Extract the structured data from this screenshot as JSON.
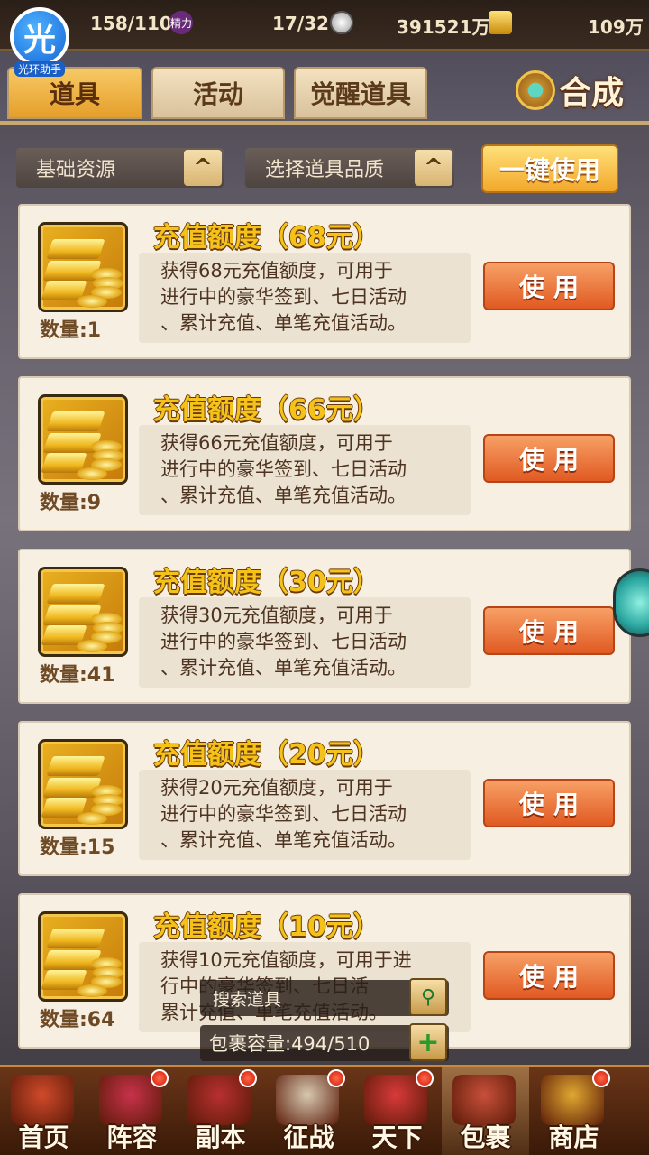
{
  "helper": {
    "badge": "光",
    "label": "光环助手"
  },
  "resources": {
    "stamina": "158/110",
    "energy_label": "精力",
    "energy": "17/32",
    "silver": "391521万",
    "gold": "109万"
  },
  "tabs": [
    {
      "label": "道具",
      "active": true
    },
    {
      "label": "活动",
      "active": false
    },
    {
      "label": "觉醒道具",
      "active": false
    }
  ],
  "combine_label": "合成",
  "filters": {
    "resource_type": "基础资源",
    "quality": "选择道具品质",
    "use_all": "一键使用"
  },
  "items": [
    {
      "title": "充值额度（68元）",
      "desc": [
        "获得68元充值额度，可用于",
        "进行中的豪华签到、七日活动",
        "、累计充值、单笔充值活动。"
      ],
      "qty": "数量:1",
      "use": "使用"
    },
    {
      "title": "充值额度（66元）",
      "desc": [
        "获得66元充值额度，可用于",
        "进行中的豪华签到、七日活动",
        "、累计充值、单笔充值活动。"
      ],
      "qty": "数量:9",
      "use": "使用"
    },
    {
      "title": "充值额度（30元）",
      "desc": [
        "获得30元充值额度，可用于",
        "进行中的豪华签到、七日活动",
        "、累计充值、单笔充值活动。"
      ],
      "qty": "数量:41",
      "use": "使用"
    },
    {
      "title": "充值额度（20元）",
      "desc": [
        "获得20元充值额度，可用于",
        "进行中的豪华签到、七日活动",
        "、累计充值、单笔充值活动。"
      ],
      "qty": "数量:15",
      "use": "使用"
    },
    {
      "title": "充值额度（10元）",
      "desc": [
        "获得10元充值额度，可用于进",
        "行中的豪华签到、七日活",
        "累计充值、单笔充值活动。"
      ],
      "qty": "数量:64",
      "use": "使用"
    }
  ],
  "search_label": "搜索道具",
  "capacity": "包裹容量:494/510",
  "nav": [
    {
      "label": "首页",
      "dot": false,
      "active": false,
      "color": "#d04a2a"
    },
    {
      "label": "阵容",
      "dot": true,
      "active": false,
      "color": "#c8324a"
    },
    {
      "label": "副本",
      "dot": true,
      "active": false,
      "color": "#b83030"
    },
    {
      "label": "征战",
      "dot": true,
      "active": false,
      "color": "#d8c8b0"
    },
    {
      "label": "天下",
      "dot": true,
      "active": false,
      "color": "#d83a3a"
    },
    {
      "label": "包裹",
      "dot": false,
      "active": true,
      "color": "#c8503a"
    },
    {
      "label": "商店",
      "dot": true,
      "active": false,
      "color": "#e0a830"
    }
  ]
}
